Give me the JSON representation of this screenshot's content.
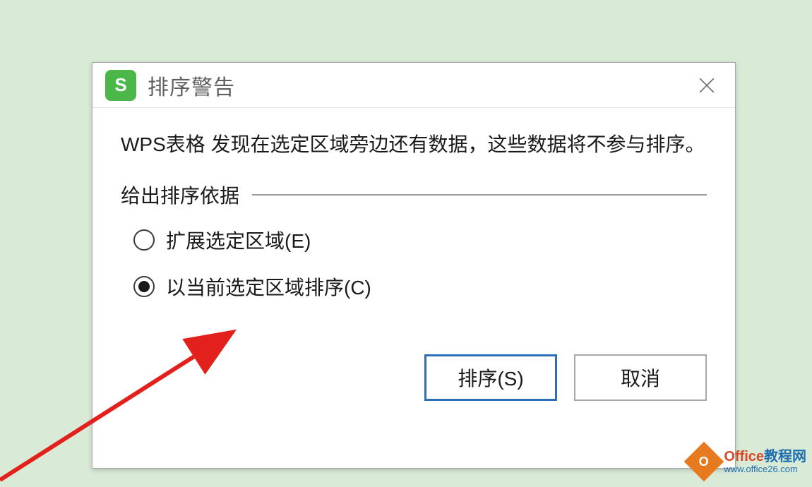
{
  "dialog": {
    "title": "排序警告",
    "message": "WPS表格 发现在选定区域旁边还有数据，这些数据将不参与排序。",
    "legend": "给出排序依据",
    "options": {
      "expand": "扩展选定区域(E)",
      "current": "以当前选定区域排序(C)"
    },
    "buttons": {
      "sort": "排序(S)",
      "cancel": "取消"
    },
    "app_icon_letter": "S"
  },
  "watermark": {
    "badge_letter": "O",
    "line1a": "Office",
    "line1b": "教程网",
    "line2": "www.office26.com"
  }
}
